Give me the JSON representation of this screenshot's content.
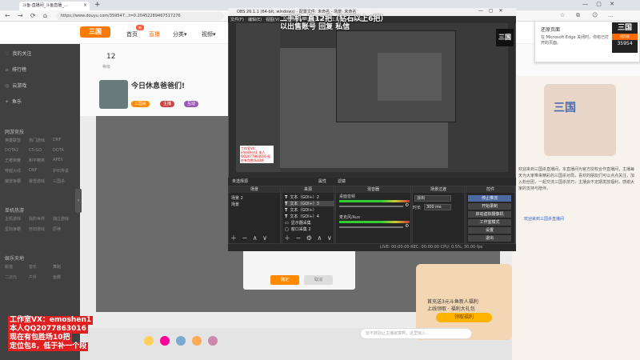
{
  "browser": {
    "tab_title": "斗鱼-直播间_斗鱼直播_...",
    "tab_close": "×",
    "new_tab": "+",
    "back": "←",
    "forward": "→",
    "refresh": "⟳",
    "home": "⌂",
    "url": "https://www.douyu.com/359547...t=0.20452289467517276",
    "window_buttons": "— ▢ ✕"
  },
  "site": {
    "logo": "三国",
    "nav": [
      "首页",
      "直播",
      "分类▾",
      "视频▾"
    ],
    "nav_badge": "新"
  },
  "sidebar": {
    "items": [
      {
        "icon": "♡",
        "label": "我的关注"
      },
      {
        "icon": "≡",
        "label": "排行榜"
      },
      {
        "icon": "◎",
        "label": "云游戏"
      },
      {
        "icon": "✦",
        "label": "鱼乐"
      }
    ],
    "sections": [
      {
        "title": "网游竞技",
        "items": [
          "英雄联盟",
          "热门游戏",
          "DNF",
          "DOTA2",
          "CS:GO",
          "DOTA",
          "王者荣耀",
          "和平精英",
          "APEX",
          "穿越火线",
          "DNF",
          "炉石传说",
          "魔兽争霸",
          "暴雪游戏",
          "三国杀"
        ]
      },
      {
        "title": "单机热游",
        "items": [
          "主机游戏",
          "我的世界",
          "独立游戏",
          "星际争霸",
          "怀旧游戏",
          "原神"
        ]
      },
      {
        "title": "娱乐天地",
        "items": [
          "颜值",
          "音乐",
          "舞蹈",
          "二次元",
          "户外",
          "鱼教"
        ]
      }
    ],
    "collapse": "‹"
  },
  "profile": {
    "stats_num": "12",
    "stats_label": "等级",
    "title": "今日休息爸爸们!",
    "pills": [
      "三国杀",
      "主播",
      "互动"
    ]
  },
  "video_dialog": {
    "primary": "确定",
    "secondary": "取消"
  },
  "right_panel": {
    "art_text": "三国",
    "text": "欢迎来到三国杀直播间，本直播间为官方授权合作直播间，主播每天为大家带来精彩的三国杀对局，喜欢的朋友们可以点点关注，加入粉丝团，一起交流三国杀技巧，主播会不定期发放福利，感谢大家的支持与陪伴。",
    "link": "欢迎来到三国杀直播间"
  },
  "promo": {
    "line1": "首充送3元斗鱼新人福利",
    "line2": "上线领取 · 福利大礼包",
    "button": "领取福利"
  },
  "chat": {
    "placeholder": "玩不转别让主播寂寞啊，这里输入..."
  },
  "obs": {
    "title": "OBS 26.1.1 (64-bit, windows) - 配置文件: 未命名 - 场景: 未命名",
    "window_buttons": "— ▢ ✕",
    "menu": [
      "文件(F)",
      "编辑(E)",
      "视图(V)",
      "配置文件(P)",
      "场景集合(S)",
      "工具(T)",
      "帮助(H)"
    ],
    "overlay_line1": "二手机=直12把（钻石以上6把）",
    "overlay_line2": "以出售账号 回复 私信",
    "preview_logo": "三国",
    "preview_note": "工作室VX：emoshen1 本人QQ2077863016 现在有包胜场10把",
    "scenebar": {
      "label": "未选择源",
      "properties": "属性",
      "filters": "滤镜"
    },
    "docks": {
      "scenes": {
        "header": "场景",
        "rows": [
          "场景 2",
          "场景"
        ],
        "foot": "＋ − ∧ ∨"
      },
      "sources": {
        "header": "来源",
        "rows": [
          "文本（GDI+）2",
          "文本（GDI+）3",
          "文本（GDI+）",
          "文本（GDI+）4",
          "显示器采集",
          "窗口采集 2"
        ],
        "foot": "＋ − ⚙ ∧ ∨"
      },
      "mixer": {
        "header": "混音器",
        "channels": [
          "桌面音频",
          "麦克风/Aux"
        ]
      },
      "transitions": {
        "header": "场景过渡",
        "fade": "淡出",
        "duration_label": "时长",
        "duration": "300 ms"
      },
      "controls": {
        "header": "控件",
        "buttons": [
          "停止推流",
          "开始录制",
          "启动虚拟摄像机",
          "工作室模式",
          "设置",
          "退出"
        ]
      }
    },
    "status": "LIVE: 00:00:00    REC: 00:00:00    CPU: 0.5%, 30.00 fps"
  },
  "notification": {
    "title": "还原页面",
    "body": "在 Microsoft Edge 关闭时，你有已打开的页面。",
    "logo_line1": "三国",
    "logo_line2": "网页版",
    "logo_line3": "35954"
  },
  "watermark": [
    "工作室VX：emoshen1",
    "本人QQ2077863016",
    "现在有包胜场10把",
    "定位包8，低于补一个段"
  ]
}
